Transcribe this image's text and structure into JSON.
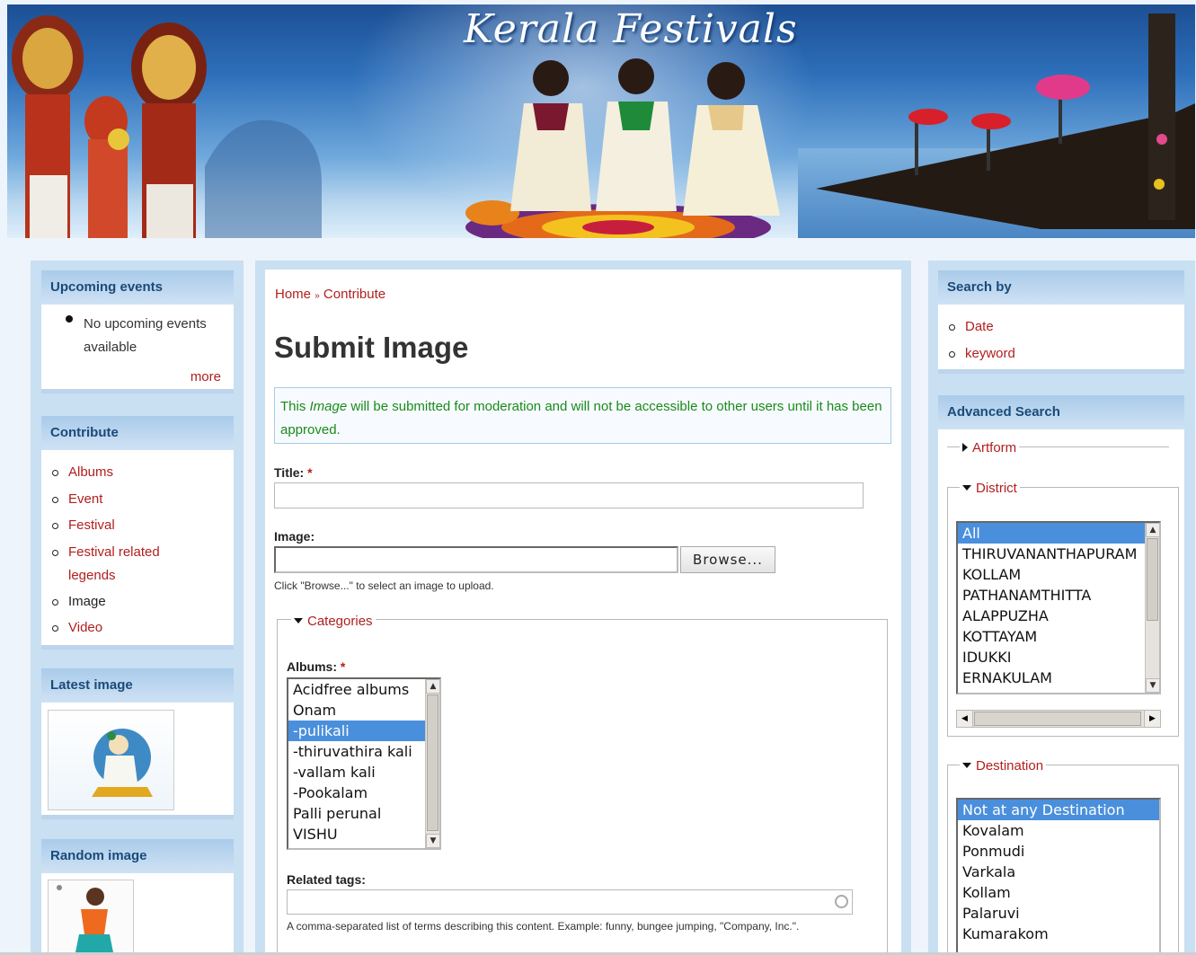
{
  "site": {
    "title": "Kerala Festivals"
  },
  "left": {
    "upcoming": {
      "title": "Upcoming events",
      "empty_text": "No upcoming events available",
      "more": "more"
    },
    "contribute": {
      "title": "Contribute",
      "items": [
        "Albums",
        "Event",
        "Festival",
        "Festival related legends",
        "Image",
        "Video"
      ]
    },
    "latest_image": {
      "title": "Latest image"
    },
    "random_image": {
      "title": "Random image"
    }
  },
  "breadcrumb": {
    "home": "Home",
    "sep": "»",
    "current": "Contribute"
  },
  "page": {
    "title": "Submit Image",
    "notice_pre": "This ",
    "notice_em": "Image",
    "notice_post": " will be submitted for moderation and will not be accessible to other users until it has been approved."
  },
  "form": {
    "title_label": "Title:",
    "required_mark": "*",
    "title_value": "",
    "image_label": "Image:",
    "browse_button": "Browse...",
    "image_help": "Click \"Browse...\" to select an image to upload.",
    "categories_legend": "Categories",
    "albums_label": "Albums:",
    "albums_options": [
      "Acidfree albums",
      "Onam",
      "-pulikali",
      "-thiruvathira kali",
      "-vallam kali",
      "-Pookalam",
      "Palli perunal",
      "VISHU"
    ],
    "albums_selected": "-pulikali",
    "related_tags_label": "Related tags:",
    "related_tags_value": "",
    "related_tags_help": "A comma-separated list of terms describing this content. Example: funny, bungee jumping, \"Company, Inc.\"."
  },
  "right": {
    "search_by": {
      "title": "Search by",
      "items": [
        "Date",
        "keyword"
      ]
    },
    "advanced": {
      "title": "Advanced Search",
      "artform_legend": "Artform",
      "district_legend": "District",
      "district_options": [
        "All",
        "THIRUVANANTHAPURAM",
        "KOLLAM",
        "PATHANAMTHITTA",
        "ALAPPUZHA",
        "KOTTAYAM",
        "IDUKKI",
        "ERNAKULAM"
      ],
      "district_selected": "All",
      "destination_legend": "Destination",
      "destination_options": [
        "Not at any Destination",
        "Kovalam",
        "Ponmudi",
        "Varkala",
        "Kollam",
        "Palaruvi",
        "Kumarakom"
      ],
      "destination_selected": "Not at any Destination"
    }
  },
  "colors": {
    "link": "#b21e1e",
    "notice_text": "#1a8a1a",
    "selection": "#4a8fdc",
    "block_title": "#1a4a7a"
  },
  "icons": [
    "bullet-icon",
    "triangle-down-icon",
    "triangle-right-icon",
    "throbber-icon",
    "scroll-arrow-icon"
  ]
}
